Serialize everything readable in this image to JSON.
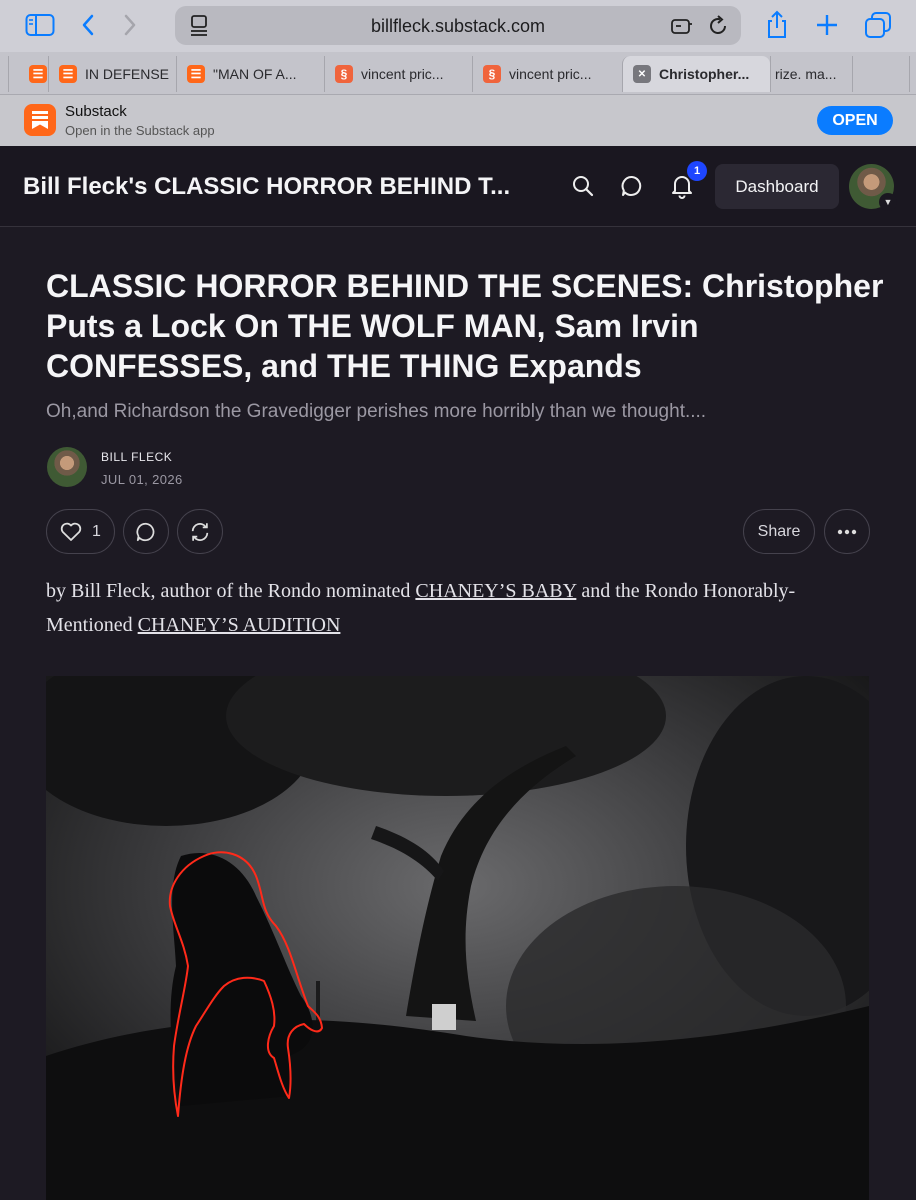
{
  "browser": {
    "url": "billfleck.substack.com",
    "tabs": [
      {
        "label": "",
        "favicon": "substack"
      },
      {
        "label": "IN DEFENSE",
        "favicon": "substack"
      },
      {
        "label": "\"MAN OF A...",
        "favicon": "substack"
      },
      {
        "label": "vincent pric...",
        "favicon": "s-red"
      },
      {
        "label": "vincent pric...",
        "favicon": "s-red"
      },
      {
        "label": "Christopher...",
        "favicon": "close",
        "active": true
      },
      {
        "label": "rize. ma...",
        "favicon": "none"
      },
      {
        "label": "",
        "favicon": "none"
      }
    ]
  },
  "app_banner": {
    "app_name": "Substack",
    "subtitle": "Open in the Substack app",
    "open_label": "OPEN"
  },
  "site": {
    "title": "Bill Fleck's CLASSIC HORROR BEHIND T...",
    "notification_count": "1",
    "dashboard_label": "Dashboard"
  },
  "post": {
    "title": "CLASSIC HORROR BEHIND THE SCENES: Christopher Puts a Lock On THE WOLF MAN, Sam Irvin CONFESSES, and THE THING Expands",
    "subtitle": "Oh,and Richardson the Gravedigger perishes more horribly than we thought....",
    "author": "BILL FLECK",
    "date": "JUL 01, 2026",
    "like_count": "1",
    "share_label": "Share",
    "body_intro": "by Bill Fleck, author of the Rondo nominated ",
    "link1": "CHANEY’S BABY",
    "body_mid": " and the Rondo Honorably-Mentioned ",
    "link2": "CHANEY’S AUDITION"
  },
  "colors": {
    "accent": "#ff6719",
    "open_button": "#0a7cff",
    "background": "#1d1a23",
    "outline_annotation": "#ff2a1a"
  }
}
